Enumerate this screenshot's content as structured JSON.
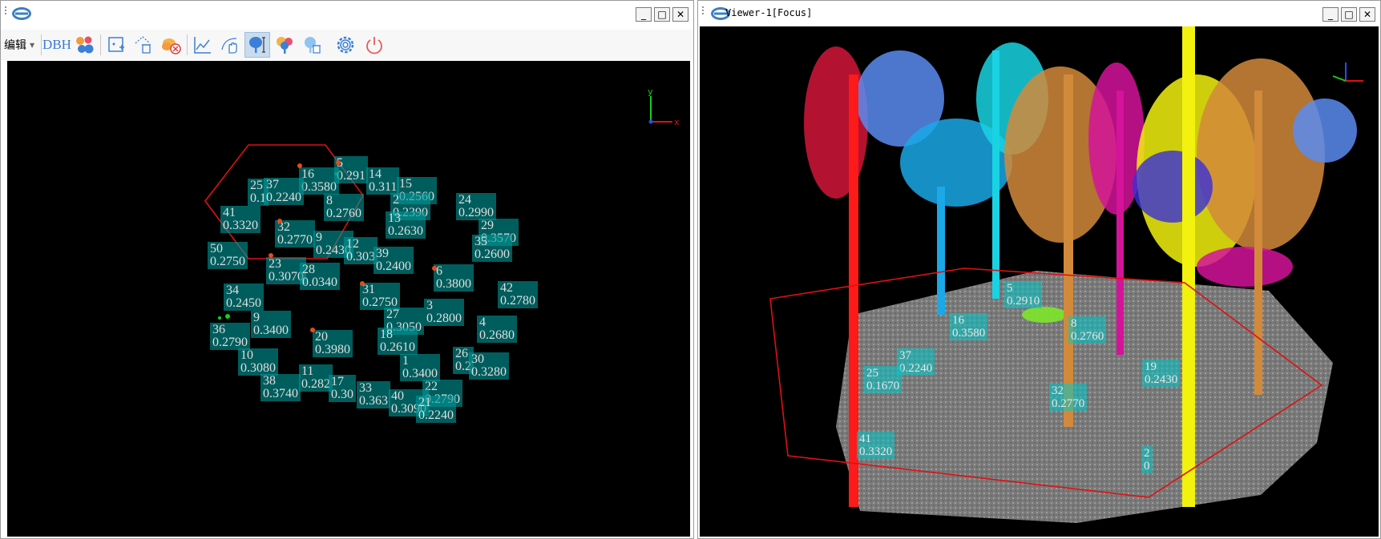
{
  "left_window": {
    "title": "",
    "buttons": {
      "minimize": "_",
      "maximize": "□",
      "close": "✕"
    },
    "toolbar": {
      "edit_menu_label": "编辑",
      "dbh_label": "DBH",
      "icons": [
        "cluster-color-icon",
        "select-box-icon",
        "clear-selection-icon",
        "remove-layer-icon",
        "profile-curve-icon",
        "hand-move-icon",
        "tree-height-icon",
        "tree-crown-icon",
        "tree-remove-icon",
        "settings-icon",
        "power-icon"
      ]
    },
    "axis": {
      "y": "y",
      "x": "x"
    },
    "trees": [
      {
        "id": "5",
        "dbh": "0.291"
      },
      {
        "id": "16",
        "dbh": "0.3580"
      },
      {
        "id": "14",
        "dbh": "0.311"
      },
      {
        "id": "15",
        "dbh": "0.2560"
      },
      {
        "id": "25",
        "dbh": "0.1"
      },
      {
        "id": "37",
        "dbh": "0.2240"
      },
      {
        "id": "24",
        "dbh": "0.2990"
      },
      {
        "id": "2",
        "dbh": "0.2390"
      },
      {
        "id": "8",
        "dbh": "0.2760"
      },
      {
        "id": "41",
        "dbh": "0.3320"
      },
      {
        "id": "13",
        "dbh": "0.2630"
      },
      {
        "id": "29",
        "dbh": "0.3570"
      },
      {
        "id": "32",
        "dbh": "0.2770"
      },
      {
        "id": "35",
        "dbh": "0.2600"
      },
      {
        "id": "9",
        "dbh": "0.2430"
      },
      {
        "id": "12",
        "dbh": "0.303"
      },
      {
        "id": "50",
        "dbh": "0.2750"
      },
      {
        "id": "39",
        "dbh": "0.2400"
      },
      {
        "id": "23",
        "dbh": "0.3070"
      },
      {
        "id": "28",
        "dbh": "0.0340"
      },
      {
        "id": "6",
        "dbh": "0.3800"
      },
      {
        "id": "42",
        "dbh": "0.2780"
      },
      {
        "id": "34",
        "dbh": "0.2450"
      },
      {
        "id": "31",
        "dbh": "0.2750"
      },
      {
        "id": "3",
        "dbh": "0.2800"
      },
      {
        "id": "27",
        "dbh": "0.3050"
      },
      {
        "id": "9",
        "dbh": "0.3400"
      },
      {
        "id": "36",
        "dbh": "0.2790"
      },
      {
        "id": "4",
        "dbh": "0.2680"
      },
      {
        "id": "18",
        "dbh": "0.2610"
      },
      {
        "id": "20",
        "dbh": "0.3980"
      },
      {
        "id": "10",
        "dbh": "0.3080"
      },
      {
        "id": "1",
        "dbh": "0.3400"
      },
      {
        "id": "26",
        "dbh": "0.2"
      },
      {
        "id": "30",
        "dbh": "0.3280"
      },
      {
        "id": "11",
        "dbh": "0.282"
      },
      {
        "id": "38",
        "dbh": "0.3740"
      },
      {
        "id": "17",
        "dbh": "0.30"
      },
      {
        "id": "33",
        "dbh": "0.363"
      },
      {
        "id": "22",
        "dbh": "0.2790"
      },
      {
        "id": "40",
        "dbh": "0.3090"
      },
      {
        "id": "21",
        "dbh": "0.2240"
      }
    ]
  },
  "right_window": {
    "title": "Viewer-1[Focus]",
    "buttons": {
      "minimize": "_",
      "maximize": "□",
      "close": "✕"
    },
    "trees": [
      {
        "id": "5",
        "dbh": "0.2910"
      },
      {
        "id": "16",
        "dbh": "0.3580"
      },
      {
        "id": "8",
        "dbh": "0.2760"
      },
      {
        "id": "37",
        "dbh": "0.2240"
      },
      {
        "id": "25",
        "dbh": "0.1670"
      },
      {
        "id": "19",
        "dbh": "0.2430"
      },
      {
        "id": "32",
        "dbh": "0.2770"
      },
      {
        "id": "41",
        "dbh": "0.3320"
      },
      {
        "id": "2",
        "dbh": "0"
      }
    ]
  },
  "colors": {
    "background": "#000000",
    "selection_polygon": "#e01010",
    "label_fill": "#009696",
    "ground_points": "#8a8a8a"
  }
}
